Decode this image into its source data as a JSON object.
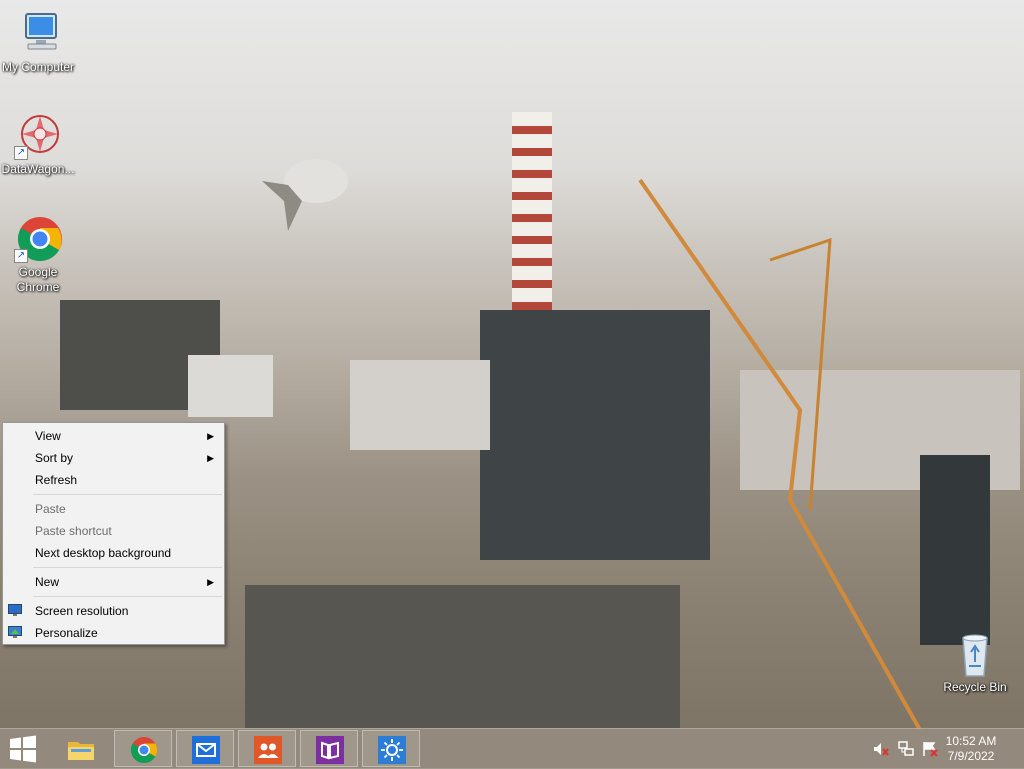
{
  "desktop": {
    "icons": [
      {
        "label": "My Computer",
        "icon": "my-computer-icon"
      },
      {
        "label": "DataWagon...",
        "icon": "datawagon-icon"
      },
      {
        "label": "Google\nChrome",
        "icon": "chrome-icon"
      },
      {
        "label": "Recycle Bin",
        "icon": "recycle-bin-icon"
      }
    ]
  },
  "context_menu": {
    "items": [
      {
        "label": "View",
        "submenu": true
      },
      {
        "label": "Sort by",
        "submenu": true
      },
      {
        "label": "Refresh"
      },
      {
        "label": "Paste",
        "disabled": true
      },
      {
        "label": "Paste shortcut",
        "disabled": true
      },
      {
        "label": "Next desktop background"
      },
      {
        "label": "New",
        "submenu": true
      },
      {
        "label": "Screen resolution",
        "icon": "screen-resolution-icon"
      },
      {
        "label": "Personalize",
        "icon": "personalize-icon"
      }
    ],
    "submenu_arrow": "▶"
  },
  "taskbar": {
    "start_icon": "windows-logo-icon",
    "pinned": [
      "file-explorer-icon",
      "chrome-icon",
      "mail-icon",
      "people-icon",
      "store-icon",
      "weather-icon"
    ],
    "tray": [
      "volume-muted-icon",
      "network-icon",
      "action-center-icon"
    ],
    "time": "10:52 AM",
    "date": "7/9/2022"
  },
  "colors": {
    "accent_blue": "#1e6fd9",
    "menu_bg": "#f2f2f2",
    "taskbar": "#968c80"
  }
}
